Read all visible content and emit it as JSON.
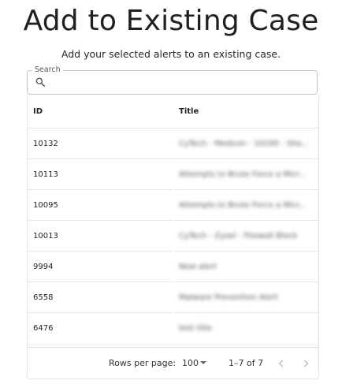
{
  "dialog": {
    "title": "Add to Existing Case",
    "subtitle": "Add your selected alerts to an existing case."
  },
  "search": {
    "label": "Search",
    "value": "",
    "placeholder": "",
    "icon": "search-icon"
  },
  "table": {
    "columns": [
      "ID",
      "Title"
    ],
    "rows": [
      {
        "id": "10132",
        "title": "CyTech - Medium - 10195 - Sho..."
      },
      {
        "id": "10113",
        "title": "Attempts to Brute Force a Micr..."
      },
      {
        "id": "10095",
        "title": "Attempts to Brute Force a Micr..."
      },
      {
        "id": "10013",
        "title": "CyTech - Zyxel - Firewall Block"
      },
      {
        "id": "9994",
        "title": "New alert"
      },
      {
        "id": "6558",
        "title": "Malware Prevention Alert"
      },
      {
        "id": "6476",
        "title": "test title"
      }
    ]
  },
  "pagination": {
    "rows_per_page_label": "Rows per page:",
    "rows_per_page": "100",
    "range": "1–7 of 7",
    "prev_icon": "chevron-left-icon",
    "next_icon": "chevron-right-icon"
  },
  "colors": {
    "border": "#c4c4c4",
    "divider": "#e6e6e6",
    "text": "#202020"
  }
}
